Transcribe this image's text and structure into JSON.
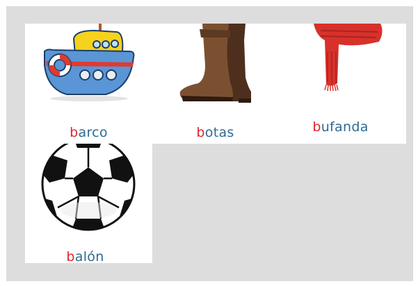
{
  "cards": [
    {
      "id": "barco",
      "first_letter": "b",
      "rest": "arco",
      "image": "boat-icon"
    },
    {
      "id": "botas",
      "first_letter": "b",
      "rest": "otas",
      "image": "boots-icon"
    },
    {
      "id": "bufanda",
      "first_letter": "b",
      "rest": "ufanda",
      "image": "scarf-icon"
    },
    {
      "id": "balon",
      "first_letter": "b",
      "rest": "alón",
      "image": "soccer-ball-icon"
    }
  ],
  "colors": {
    "background": "#dddddd",
    "card": "#ffffff",
    "first_letter": "#e0242e",
    "word": "#2d6a93"
  }
}
